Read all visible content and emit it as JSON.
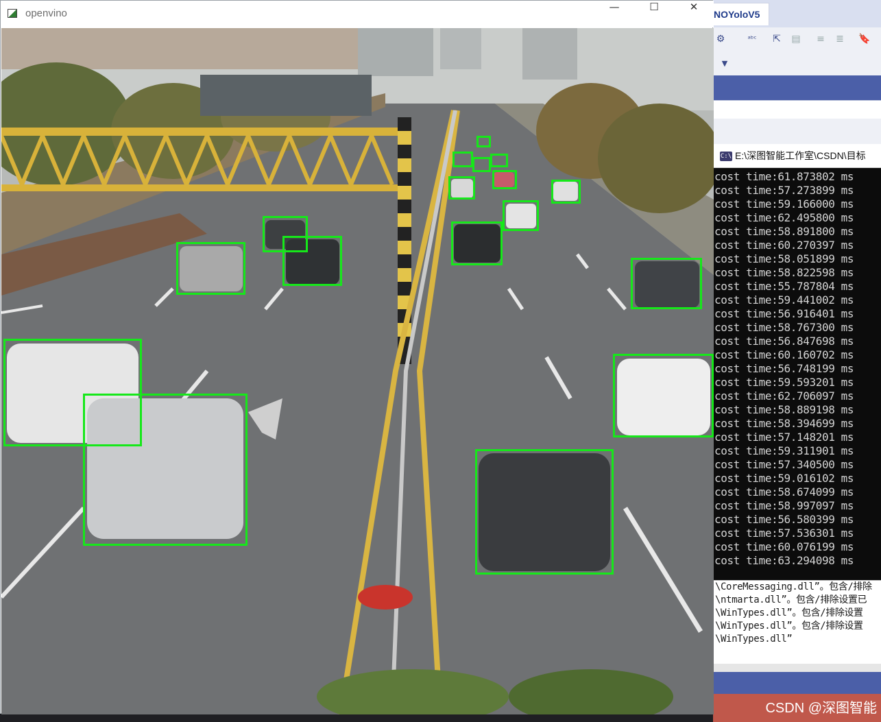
{
  "window": {
    "title": "openvino",
    "controls": {
      "minimize": "—",
      "maximize": "☐",
      "close": "✕"
    }
  },
  "detections": [
    {
      "label": "car"
    },
    {
      "label": "car"
    },
    {
      "label": "car"
    },
    {
      "label": "car"
    },
    {
      "label": "car"
    },
    {
      "label": "car"
    },
    {
      "label": "car"
    },
    {
      "label": "car"
    },
    {
      "label": "car"
    },
    {
      "label": "car"
    },
    {
      "label": "car"
    },
    {
      "label": "car"
    },
    {
      "label": "car"
    },
    {
      "label": "car"
    },
    {
      "label": "car"
    },
    {
      "label": "car"
    },
    {
      "label": "car"
    }
  ],
  "ide": {
    "tab_title": "NOYoloV5",
    "toolbar_icons": [
      "settings-icon",
      "spellcheck-icon",
      "cursor-icon",
      "document-icon",
      "indent-icon",
      "outdent-icon",
      "bookmark-icon",
      "dropdown-icon"
    ]
  },
  "console": {
    "title": "E:\\深图智能工作室\\CSDN\\目标",
    "lines": [
      "cost time:61.873802 ms",
      "cost time:57.273899 ms",
      "cost time:59.166000 ms",
      "cost time:62.495800 ms",
      "cost time:58.891800 ms",
      "cost time:60.270397 ms",
      "cost time:58.051899 ms",
      "cost time:58.822598 ms",
      "cost time:55.787804 ms",
      "cost time:59.441002 ms",
      "cost time:56.916401 ms",
      "cost time:58.767300 ms",
      "cost time:56.847698 ms",
      "cost time:60.160702 ms",
      "cost time:56.748199 ms",
      "cost time:59.593201 ms",
      "cost time:62.706097 ms",
      "cost time:58.889198 ms",
      "cost time:58.394699 ms",
      "cost time:57.148201 ms",
      "cost time:59.311901 ms",
      "cost time:57.340500 ms",
      "cost time:59.016102 ms",
      "cost time:58.674099 ms",
      "cost time:58.997097 ms",
      "cost time:56.580399 ms",
      "cost time:57.536301 ms",
      "cost time:60.076199 ms",
      "cost time:63.294098 ms"
    ]
  },
  "output": {
    "lines": [
      "\\CoreMessaging.dll”。包含/排除",
      "\\ntmarta.dll”。包含/排除设置已",
      "\\WinTypes.dll”。包含/排除设置",
      "\\WinTypes.dll”。包含/排除设置",
      "\\WinTypes.dll”"
    ]
  },
  "watermark": "CSDN @深图智能",
  "colors": {
    "detection_box": "#16e81a",
    "console_bg": "#0c0c0c",
    "ide_accent": "#4b5fa8",
    "status_bar": "#c0584b"
  }
}
